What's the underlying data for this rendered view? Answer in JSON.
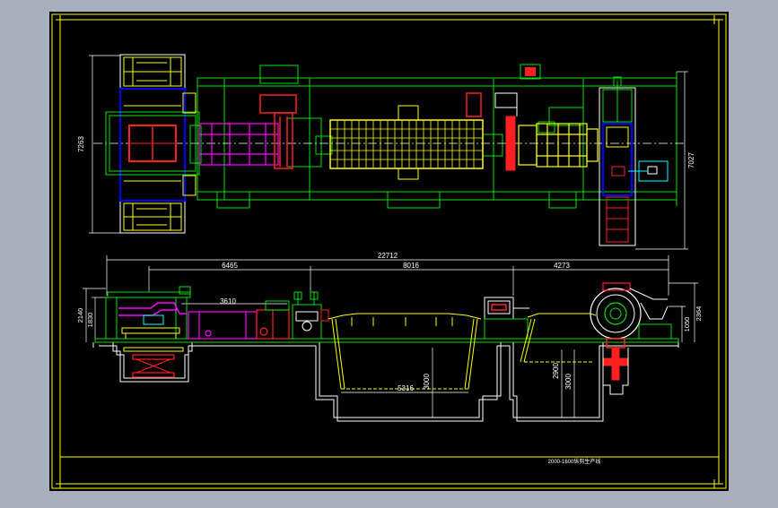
{
  "drawing": {
    "title_block_text": "2000-1600纵剪生产线",
    "colors": {
      "background_grey": "#a8b0bd",
      "sheet": "#000000",
      "border_yellow": "#ffff00",
      "frame_green": "#00e000",
      "cyan": "#00ffff",
      "red": "#ff2020",
      "magenta": "#ff00ff",
      "white": "#ffffff"
    }
  },
  "plan_view": {
    "dim_left_height": "7263",
    "dim_right_height": "7027"
  },
  "elevation_view": {
    "dim_total_length": "22712",
    "dim_segment_1": "6465",
    "dim_segment_2": "8016",
    "dim_segment_3": "4273",
    "dim_entry_section": "3610",
    "dim_left_height_outer": "2140",
    "dim_left_height_inner": "1830",
    "dim_right_height_outer": "2364",
    "dim_right_height_inner": "1050",
    "dim_pit1_width": "5316",
    "dim_pit1_depth": "3000",
    "dim_pit2_depth_a": "2900",
    "dim_pit2_depth_b": "3000"
  }
}
